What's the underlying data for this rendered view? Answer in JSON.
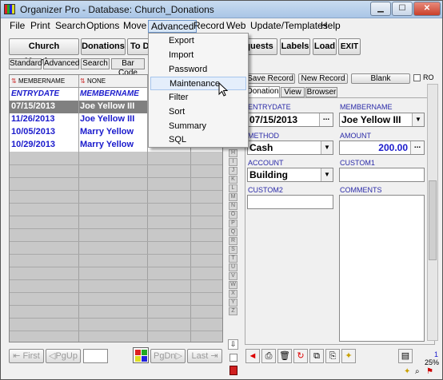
{
  "window": {
    "title": "Organizer Pro - Database: Church_Donations"
  },
  "menu": [
    "File",
    "Print",
    "Search",
    "Options",
    "Move",
    "Advanced",
    "Record",
    "Web",
    "Update/Templates",
    "Help"
  ],
  "advanced_menu": [
    "Export",
    "Import",
    "Password",
    "Maintenance",
    "Filter",
    "Sort",
    "Summary",
    "SQL"
  ],
  "toolbar": {
    "church_members": "Church Members",
    "donations": "Donations",
    "to_do": "To D",
    "requests": "quests",
    "labels": "Labels",
    "load": "Load",
    "exit": "EXIT"
  },
  "list_tabs": [
    "Standard",
    "Advanced",
    "Search",
    "Bar Code"
  ],
  "grid": {
    "col1_header": "MEMBERNAME",
    "col2_header": "NONE",
    "sub1": "ENTRYDATE",
    "sub2": "MEMBERNAME",
    "rows": [
      {
        "date": "07/15/2013",
        "name": "Joe Yellow III"
      },
      {
        "date": "11/26/2013",
        "name": "Joe Yellow III"
      },
      {
        "date": "10/05/2013",
        "name": "Marry Yellow"
      },
      {
        "date": "10/29/2013",
        "name": "Marry Yellow"
      }
    ]
  },
  "alphabet": [
    "H",
    "I",
    "J",
    "K",
    "L",
    "M",
    "N",
    "O",
    "P",
    "Q",
    "R",
    "S",
    "T",
    "U",
    "V",
    "W",
    "X",
    "Y",
    "Z"
  ],
  "nav": {
    "first": "First",
    "pgup": "PgUp",
    "pgdn": "PgDn",
    "last": "Last"
  },
  "record_buttons": {
    "save": "Save Record",
    "new": "New Record",
    "blank": "Blank",
    "ro": "RO"
  },
  "form_tabs": [
    "Donation",
    "View",
    "Browser"
  ],
  "form": {
    "entrydate_label": "ENTRYDATE",
    "entrydate": "07/15/2013",
    "membername_label": "MEMBERNAME",
    "membername": "Joe Yellow III",
    "method_label": "METHOD",
    "method": "Cash",
    "amount_label": "AMOUNT",
    "amount": "200.00",
    "account_label": "ACCOUNT",
    "account": "Building",
    "custom1_label": "CUSTOM1",
    "custom2_label": "CUSTOM2",
    "comments_label": "COMMENTS"
  },
  "status": {
    "record": "1",
    "zoom": "25%"
  },
  "colors": {
    "accent_blue": "#1a1acc",
    "selected_row": "#808080",
    "menu_hover": "#e4eefb"
  }
}
